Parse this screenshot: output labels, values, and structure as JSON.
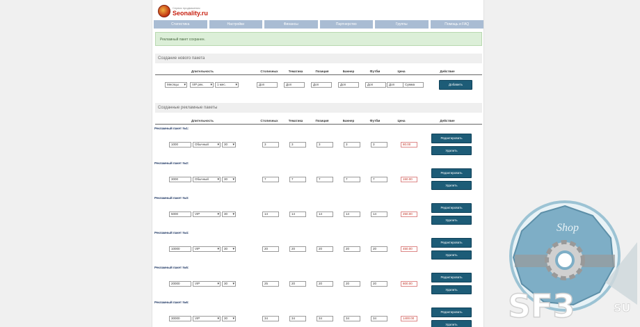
{
  "header": {
    "tagline": "Сервис продвижения",
    "site_name": "Seonality.ru"
  },
  "nav": [
    {
      "label": "Статистика"
    },
    {
      "label": "Настройки"
    },
    {
      "label": "Финансы"
    },
    {
      "label": "Партнерство"
    },
    {
      "label": "Группы"
    },
    {
      "label": "Помощь и FAQ"
    }
  ],
  "notice": {
    "text": "Рекламный пакет сохранен."
  },
  "create_section": {
    "title": "Создание нового пакета",
    "headers": [
      "Длительность",
      "Столичных",
      "Тематика",
      "Позиция",
      "Баннер",
      "Футбм",
      "Цена",
      "Действие"
    ],
    "form": {
      "duration_select": "Месяцы",
      "type_select": "VIP рек.",
      "period_select": "1 мес.",
      "fields": [
        "Доп",
        "Доп",
        "Доп",
        "Доп",
        "Доп",
        "Доп"
      ],
      "price_placeholder": "Сумма",
      "add_label": "Добавить"
    }
  },
  "list_section": {
    "title": "Созданные рекламные пакеты",
    "headers": [
      "Длительность",
      "Столичных",
      "Тематика",
      "Позиция",
      "Баннер",
      "Футбм",
      "Цена",
      "Действие"
    ],
    "edit_label": "Редактировать",
    "delete_label": "Удалить",
    "packages": [
      {
        "label": "Рекламный пакет №1:",
        "amount": "1000",
        "type": "Обычный",
        "days": "30",
        "values": [
          "3",
          "3",
          "3",
          "3",
          "3"
        ],
        "price": "80.00"
      },
      {
        "label": "Рекламный пакет №2:",
        "amount": "3000",
        "type": "Обычный",
        "days": "30",
        "values": [
          "7",
          "7",
          "7",
          "7",
          "7"
        ],
        "price": "150.00"
      },
      {
        "label": "Рекламный пакет №3:",
        "amount": "5000",
        "type": "VIP",
        "days": "30",
        "values": [
          "14",
          "14",
          "14",
          "14",
          "14"
        ],
        "price": "250.00"
      },
      {
        "label": "Рекламный пакет №4:",
        "amount": "10000",
        "type": "VIP",
        "days": "30",
        "values": [
          "20",
          "20",
          "20",
          "20",
          "20"
        ],
        "price": "450.00"
      },
      {
        "label": "Рекламный пакет №5:",
        "amount": "20000",
        "type": "VIP",
        "days": "30",
        "values": [
          "25",
          "20",
          "20",
          "20",
          "20"
        ],
        "price": "800.00"
      },
      {
        "label": "Рекламный пакет №6:",
        "amount": "30000",
        "type": "VIP",
        "days": "30",
        "values": [
          "34",
          "34",
          "34",
          "34",
          "34"
        ],
        "price": "1400.00"
      }
    ]
  },
  "watermark": {
    "brand": "SF3",
    "suffix": "SU",
    "badge_text": "Shop"
  },
  "colors": {
    "primary_button": "#1d5c77",
    "nav": "#a9bcd3",
    "notice_bg": "#dcefd8",
    "price_text": "#c03020"
  }
}
